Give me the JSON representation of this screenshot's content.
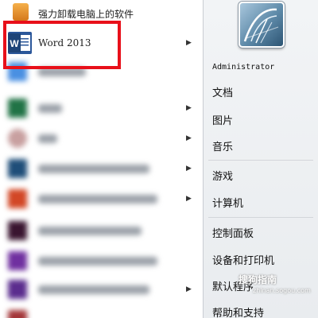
{
  "programs": [
    {
      "label": "强力卸载电脑上的软件",
      "icon": "uninstaller-box-icon",
      "color": "#e08a2c",
      "has_arrow": false,
      "blurred": false
    },
    {
      "label": "Word 2013",
      "icon": "word-icon",
      "color": "#2b579a",
      "has_arrow": true,
      "blurred": false
    },
    {
      "label": "",
      "icon": "blurred-app-icon",
      "color": "#4a90e2",
      "has_arrow": false,
      "blurred": true
    },
    {
      "label": "",
      "icon": "excel-icon",
      "color": "#217346",
      "has_arrow": true,
      "blurred": true
    },
    {
      "label": "",
      "icon": "blurred-app-icon",
      "color": "#c8a0a0",
      "has_arrow": true,
      "blurred": true
    },
    {
      "label": "",
      "icon": "blurred-app-icon",
      "color": "#1f4e79",
      "has_arrow": true,
      "blurred": true
    },
    {
      "label": "",
      "icon": "powerpoint-icon",
      "color": "#d24726",
      "has_arrow": true,
      "blurred": true
    },
    {
      "label": "",
      "icon": "blurred-app-icon",
      "color": "#3a1530",
      "has_arrow": false,
      "blurred": true
    },
    {
      "label": "",
      "icon": "onenote-icon",
      "color": "#7030a0",
      "has_arrow": false,
      "blurred": true
    },
    {
      "label": "",
      "icon": "blurred-app-icon",
      "color": "#5b2d8e",
      "has_arrow": true,
      "blurred": true
    },
    {
      "label": "",
      "icon": "access-icon",
      "color": "#a4373a",
      "has_arrow": false,
      "blurred": true
    }
  ],
  "right_pane": {
    "user": "Administrator",
    "documents": "文档",
    "pictures": "图片",
    "music": "音乐",
    "games": "游戏",
    "computer": "计算机",
    "control_panel": "控制面板",
    "devices_printers": "设备和打印机",
    "default_programs": "默认程序",
    "help_support": "帮助和支持"
  },
  "watermark": {
    "text": "搜狗指南",
    "sub": "zhinan.sogou.com"
  }
}
